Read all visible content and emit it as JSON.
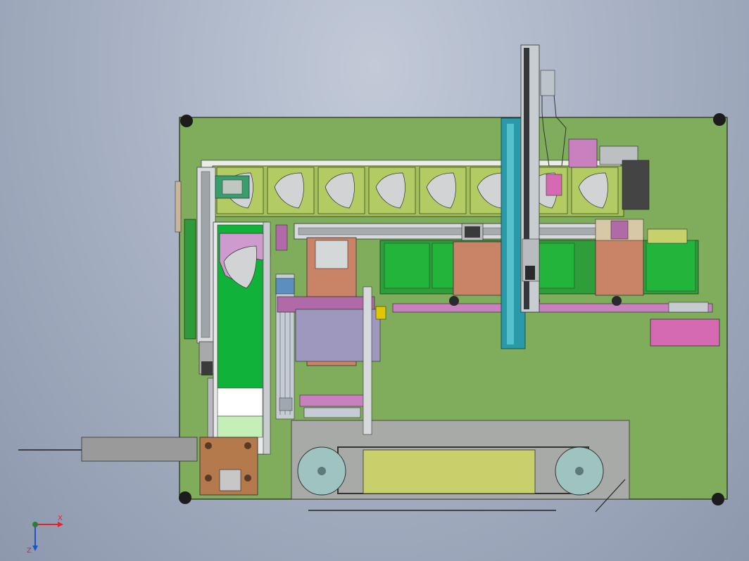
{
  "viewport": {
    "background": "#a9b3c5",
    "model": "mask-machine-assembly-top-view"
  },
  "colors": {
    "base_plate": "#80ad5b",
    "outline": "#1f2a1a",
    "frame_green": "#2f9a3a",
    "bright_green": "#11b23a",
    "salmon": "#c98467",
    "magenta": "#b06aa8",
    "pink": "#d66ab2",
    "teal": "#2a9aa8",
    "olive": "#c7d06b",
    "grey": "#9a9a9a",
    "steel": "#c8cdd2",
    "dark": "#2a2a2a",
    "yellow": "#e0c700",
    "brown": "#b47a4c"
  },
  "triad": {
    "x_label": "X",
    "z_label": "Z",
    "icon": "coordinate-triad-icon"
  }
}
